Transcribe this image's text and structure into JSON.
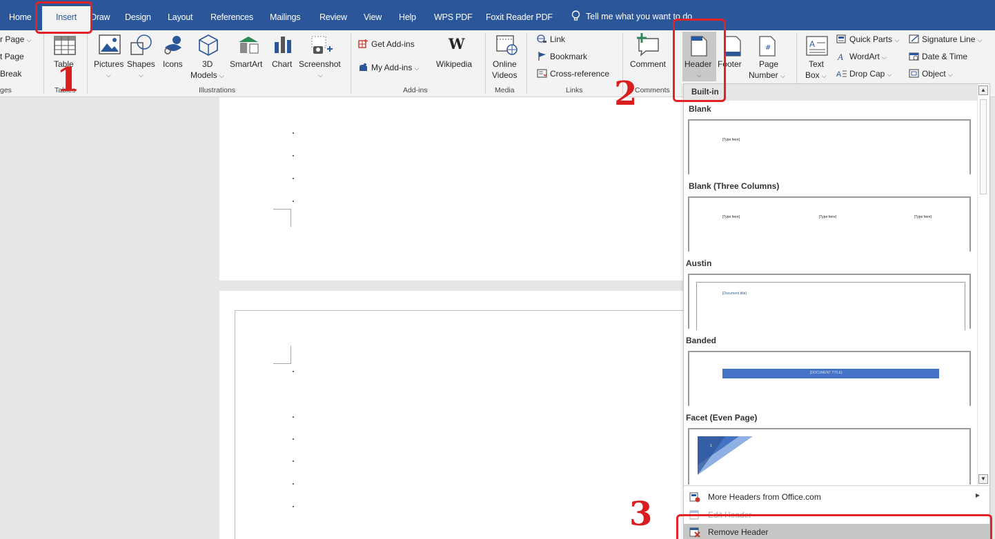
{
  "tabs": [
    "Home",
    "Insert",
    "Draw",
    "Design",
    "Layout",
    "References",
    "Mailings",
    "Review",
    "View",
    "Help",
    "WPS PDF",
    "Foxit Reader PDF"
  ],
  "tell_me": "Tell me what you want to do",
  "ribbon": {
    "pages": {
      "cover_page": "r Page",
      "blank_page": "t Page",
      "page_break": "Break",
      "group": "ges"
    },
    "tables": {
      "table": "Table",
      "group": "Tables"
    },
    "illustrations": {
      "pictures": "Pictures",
      "shapes": "Shapes",
      "icons": "Icons",
      "models_3d": "3D",
      "models_3d_2": "Models",
      "smartart": "SmartArt",
      "chart": "Chart",
      "screenshot": "Screenshot",
      "group": "Illustrations"
    },
    "addins": {
      "get_addins": "Get Add-ins",
      "my_addins": "My Add-ins",
      "wikipedia": "Wikipedia",
      "group": "Add-ins"
    },
    "media": {
      "online": "Online",
      "videos": "Videos",
      "group": "Media"
    },
    "links": {
      "link": "Link",
      "bookmark": "Bookmark",
      "cross_reference": "Cross-reference",
      "group": "Links"
    },
    "comments": {
      "comment": "Comment",
      "group": "Comments"
    },
    "header_footer": {
      "header": "Header",
      "footer": "Footer",
      "page": "Page",
      "number": "Number"
    },
    "text": {
      "text": "Text",
      "box": "Box",
      "quick_parts": "Quick Parts",
      "wordart": "WordArt",
      "drop_cap": "Drop Cap",
      "signature_line": "Signature Line",
      "date_time": "Date & Time",
      "object": "Object"
    }
  },
  "gallery": {
    "section": "Built-in",
    "items": [
      {
        "name": "Blank",
        "placeholder": "[Type here]"
      },
      {
        "name": "Blank (Three Columns)",
        "placeholder": "[Type here]"
      },
      {
        "name": "Austin",
        "placeholder": "[Document title]"
      },
      {
        "name": "Banded",
        "placeholder": "[DOCUMENT TITLE]"
      },
      {
        "name": "Facet (Even Page)",
        "placeholder": "1"
      }
    ],
    "more": "More Headers from Office.com",
    "edit": "Edit Header",
    "remove": "Remove Header"
  },
  "annotations": {
    "step1": "1",
    "step2": "2",
    "step3": "3"
  },
  "colors": {
    "accent": "#2b579a",
    "annotation": "#e32226",
    "banded": "#4472c4"
  }
}
